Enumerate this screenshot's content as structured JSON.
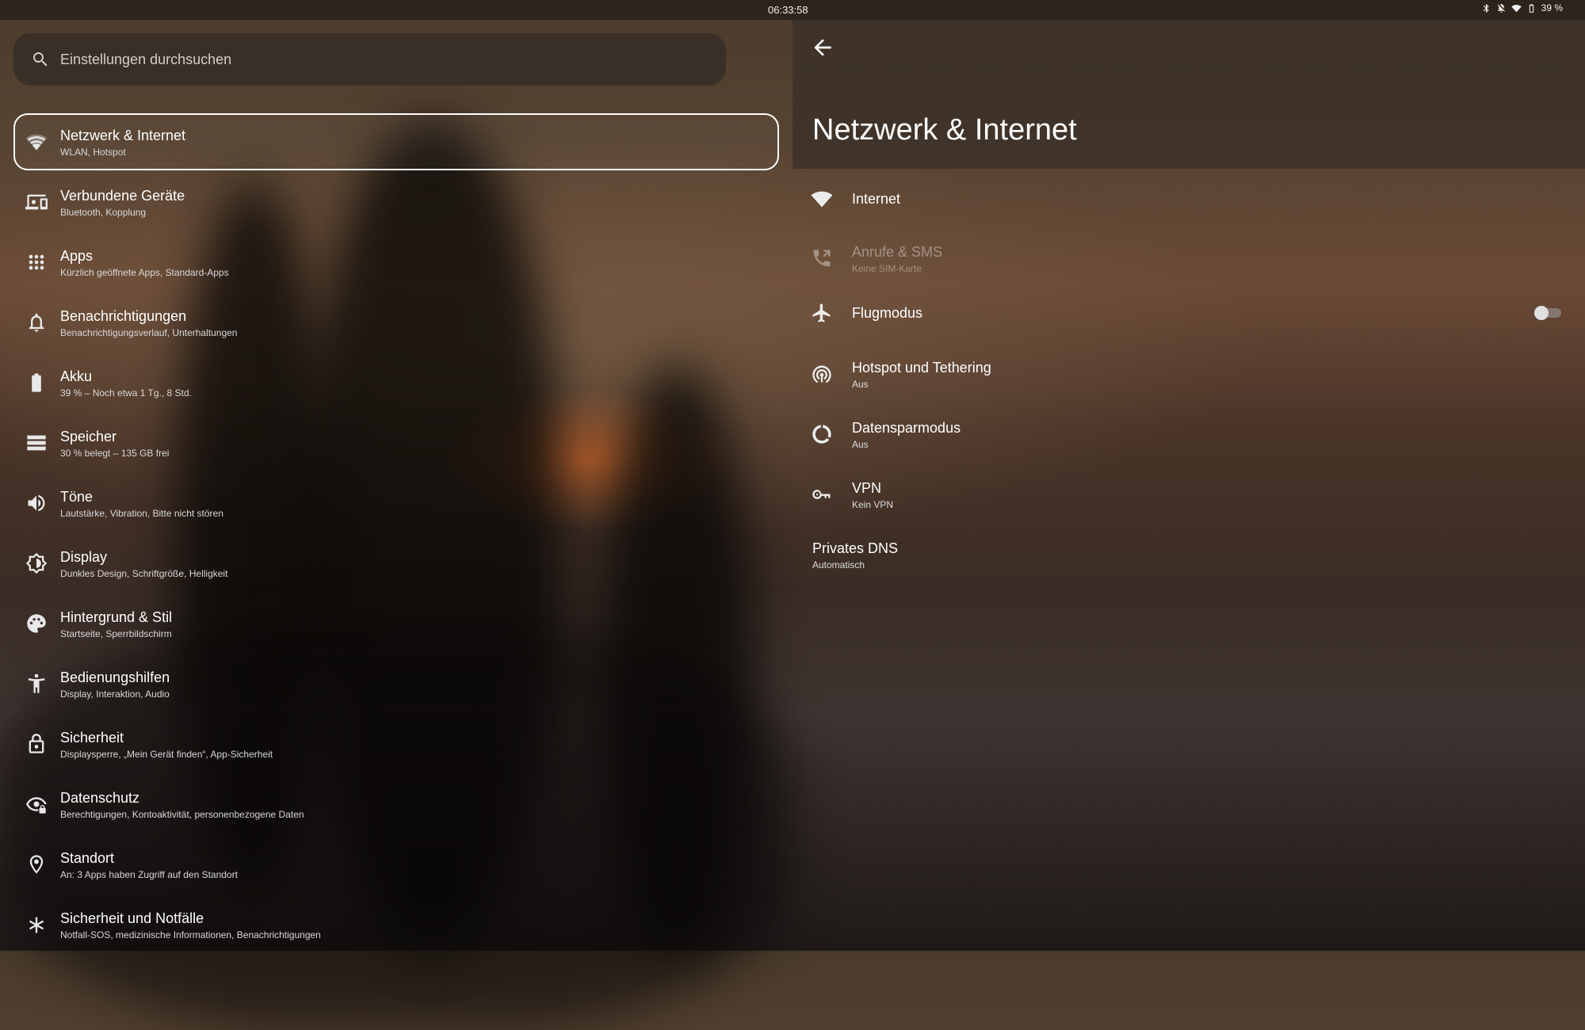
{
  "status_bar": {
    "time": "06:33:58",
    "battery": "39 %"
  },
  "search": {
    "placeholder": "Einstellungen durchsuchen"
  },
  "sidebar": {
    "items": [
      {
        "title": "Netzwerk & Internet",
        "subtitle": "WLAN, Hotspot",
        "icon": "wifi-icon",
        "selected": true
      },
      {
        "title": "Verbundene Geräte",
        "subtitle": "Bluetooth, Kopplung",
        "icon": "devices-icon"
      },
      {
        "title": "Apps",
        "subtitle": "Kürzlich geöffnete Apps, Standard-Apps",
        "icon": "apps-grid-icon"
      },
      {
        "title": "Benachrichtigungen",
        "subtitle": "Benachrichtigungsverlauf, Unterhaltungen",
        "icon": "bell-icon"
      },
      {
        "title": "Akku",
        "subtitle": "39 % – Noch etwa 1 Tg., 8 Std.",
        "icon": "battery-icon"
      },
      {
        "title": "Speicher",
        "subtitle": "30 % belegt – 135 GB frei",
        "icon": "storage-icon"
      },
      {
        "title": "Töne",
        "subtitle": "Lautstärke, Vibration, Bitte nicht stören",
        "icon": "volume-icon"
      },
      {
        "title": "Display",
        "subtitle": "Dunkles Design, Schriftgröße, Helligkeit",
        "icon": "brightness-icon"
      },
      {
        "title": "Hintergrund & Stil",
        "subtitle": "Startseite, Sperrbildschirm",
        "icon": "palette-icon"
      },
      {
        "title": "Bedienungshilfen",
        "subtitle": "Display, Interaktion, Audio",
        "icon": "accessibility-icon"
      },
      {
        "title": "Sicherheit",
        "subtitle": "Displaysperre, „Mein Gerät finden“, App-Sicherheit",
        "icon": "lock-icon"
      },
      {
        "title": "Datenschutz",
        "subtitle": "Berechtigungen, Kontoaktivität, personenbezogene Daten",
        "icon": "privacy-eye-icon"
      },
      {
        "title": "Standort",
        "subtitle": "An: 3 Apps haben Zugriff auf den Standort",
        "icon": "location-pin-icon"
      },
      {
        "title": "Sicherheit und Notfälle",
        "subtitle": "Notfall-SOS, medizinische Informationen, Benachrichtigungen",
        "icon": "asterisk-icon"
      }
    ]
  },
  "detail": {
    "title": "Netzwerk & Internet",
    "items": [
      {
        "title": "Internet",
        "subtitle": "",
        "icon": "wifi-icon"
      },
      {
        "title": "Anrufe & SMS",
        "subtitle": "Keine SIM-Karte",
        "icon": "phone-forward-icon",
        "disabled": true
      },
      {
        "title": "Flugmodus",
        "subtitle": "",
        "icon": "airplane-icon",
        "toggle": false
      },
      {
        "title": "Hotspot und Tethering",
        "subtitle": "Aus",
        "icon": "hotspot-icon"
      },
      {
        "title": "Datensparmodus",
        "subtitle": "Aus",
        "icon": "data-saver-icon"
      },
      {
        "title": "VPN",
        "subtitle": "Kein VPN",
        "icon": "vpn-key-icon"
      },
      {
        "title": "Privates DNS",
        "subtitle": "Automatisch",
        "icon": ""
      }
    ]
  }
}
